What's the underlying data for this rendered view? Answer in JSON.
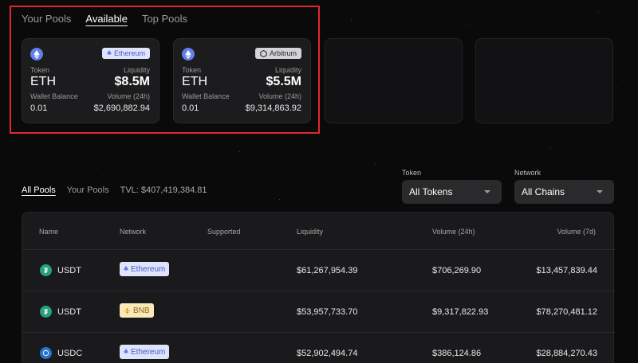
{
  "top_tabs": {
    "your_pools": "Your Pools",
    "available": "Available",
    "top_pools": "Top Pools"
  },
  "cards": [
    {
      "network": "Ethereum",
      "token_label": "Token",
      "token": "ETH",
      "liquidity_label": "Liquidity",
      "liquidity": "$8.5M",
      "wallet_label": "Wallet Balance",
      "wallet": "0.01",
      "volume_label": "Volume (24h)",
      "volume": "$2,690,882.94"
    },
    {
      "network": "Arbitrum",
      "token_label": "Token",
      "token": "ETH",
      "liquidity_label": "Liquidity",
      "liquidity": "$5.5M",
      "wallet_label": "Wallet Balance",
      "wallet": "0.01",
      "volume_label": "Volume (24h)",
      "volume": "$9,314,863.92"
    }
  ],
  "mid_tabs": {
    "all_pools": "All Pools",
    "your_pools": "Your Pools",
    "tvl": "TVL: $407,419,384.81"
  },
  "filters": {
    "token_label": "Token",
    "token_value": "All Tokens",
    "network_label": "Network",
    "network_value": "All Chains"
  },
  "table": {
    "headers": {
      "name": "Name",
      "network": "Network",
      "supported": "Supported",
      "liquidity": "Liquidity",
      "vol24": "Volume (24h)",
      "vol7": "Volume (7d)"
    },
    "rows": [
      {
        "name": "USDT",
        "network": "Ethereum",
        "liquidity": "$61,267,954.39",
        "vol24": "$706,269.90",
        "vol7": "$13,457,839.44"
      },
      {
        "name": "USDT",
        "network": "BNB",
        "liquidity": "$53,957,733.70",
        "vol24": "$9,317,822.93",
        "vol7": "$78,270,481.12"
      },
      {
        "name": "USDC",
        "network": "Ethereum",
        "liquidity": "$52,902,494.74",
        "vol24": "$386,124.86",
        "vol7": "$28,884,270.43"
      }
    ]
  },
  "colors": {
    "background": "#0a0a0a",
    "highlight": "#e0282e",
    "eth_badge": "#dfe4fb",
    "bnb_badge": "#fbeab9"
  }
}
